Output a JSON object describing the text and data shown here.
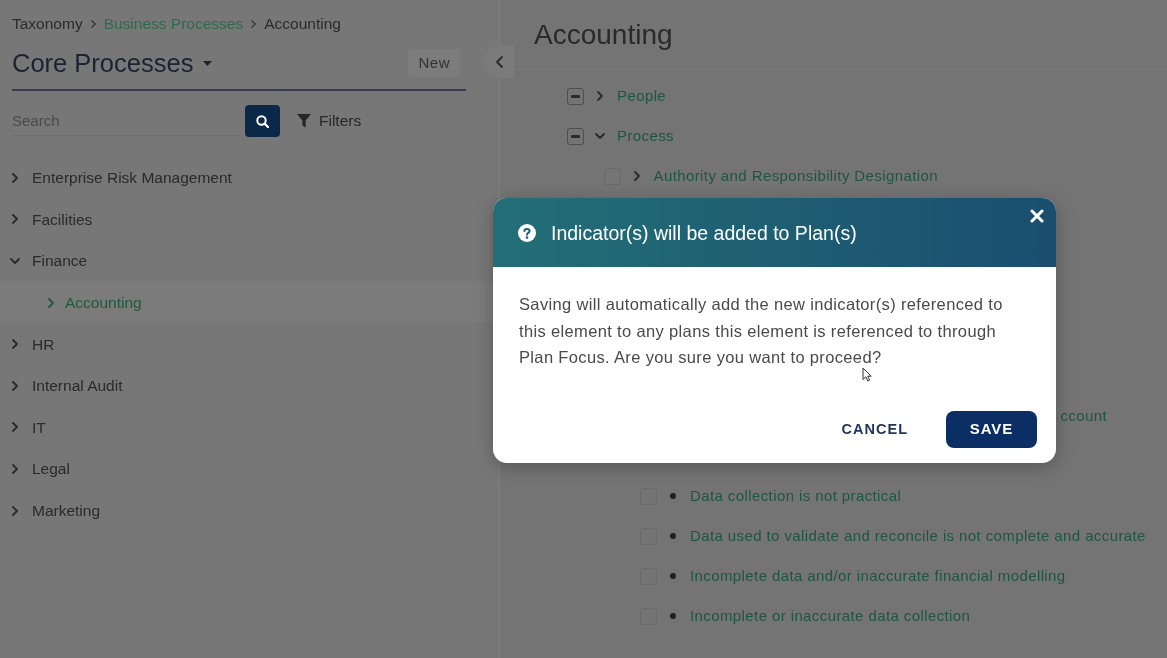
{
  "breadcrumb": [
    {
      "label": "Taxonomy",
      "link": false
    },
    {
      "label": "Business Processes",
      "link": true
    },
    {
      "label": "Accounting",
      "link": false
    }
  ],
  "sidebar": {
    "title": "Core Processes",
    "new_button": "New",
    "search": {
      "placeholder": "Search"
    },
    "filters_button": "Filters",
    "items": [
      {
        "label": "Enterprise Risk Management",
        "expanded": false,
        "selected": false
      },
      {
        "label": "Facilities",
        "expanded": false,
        "selected": false
      },
      {
        "label": "Finance",
        "expanded": true,
        "selected": false,
        "children": [
          {
            "label": "Accounting",
            "expanded": false,
            "selected": true
          }
        ]
      },
      {
        "label": "HR",
        "expanded": false,
        "selected": false
      },
      {
        "label": "Internal Audit",
        "expanded": false,
        "selected": false
      },
      {
        "label": "IT",
        "expanded": false,
        "selected": false
      },
      {
        "label": "Legal",
        "expanded": false,
        "selected": false
      },
      {
        "label": "Marketing",
        "expanded": false,
        "selected": false
      }
    ]
  },
  "content": {
    "title": "Accounting",
    "tree": [
      {
        "kind": "branch",
        "label": "People",
        "expanded": false,
        "checked": true,
        "indeterminate": true
      },
      {
        "kind": "branch",
        "label": "Process",
        "expanded": true,
        "checked": true,
        "indeterminate": true,
        "children": [
          {
            "kind": "branch",
            "label": "Authority and Responsibility Designation",
            "expanded": false,
            "checked": false,
            "indeterminate": false
          },
          {
            "kind": "partial",
            "label": "ccount",
            "children": [
              {
                "kind": "leaf",
                "label": "Data collection is not practical",
                "checked": false
              },
              {
                "kind": "leaf",
                "label": "Data used to validate and reconcile is not complete and accurate",
                "checked": false
              },
              {
                "kind": "leaf",
                "label": "Incomplete data and/or inaccurate financial modelling",
                "checked": false
              },
              {
                "kind": "leaf",
                "label": "Incomplete or inaccurate data collection",
                "checked": false
              }
            ]
          }
        ]
      }
    ]
  },
  "dialog": {
    "title": "Indicator(s) will be added to Plan(s)",
    "message": "Saving will automatically add the new indicator(s) referenced to this element to any plans this element is referenced to through Plan Focus. Are you sure you want to proceed?",
    "buttons": [
      {
        "label": "CANCEL",
        "kind": "secondary"
      },
      {
        "label": "SAVE",
        "kind": "primary"
      }
    ]
  }
}
